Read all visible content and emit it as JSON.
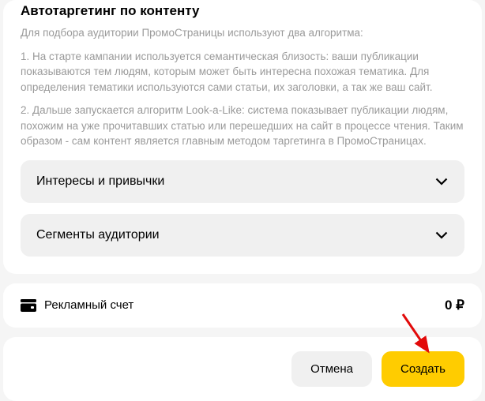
{
  "content": {
    "title": "Автотаргетинг по контенту",
    "intro": "Для подбора аудитории ПромоСтраницы используют два алгоритма:",
    "paragraph1": "1. На старте кампании используется семантическая близость: ваши публикации показываются тем людям, которым может быть интересна похожая тематика. Для определения тематики используются сами статьи, их заголовки, а так же ваш сайт.",
    "paragraph2": "2. Дальше запускается алгоритм Look-a-Like: система показывает публикации людям, похожим на уже прочитавших статью или перешедших на сайт в процессе чтения. Таким образом - сам контент является главным методом таргетинга в ПромоСтраницах."
  },
  "accordions": {
    "interests": "Интересы и привычки",
    "segments": "Сегменты аудитории"
  },
  "account": {
    "label": "Рекламный счет",
    "balance": "0 ₽"
  },
  "actions": {
    "cancel": "Отмена",
    "create": "Создать"
  }
}
